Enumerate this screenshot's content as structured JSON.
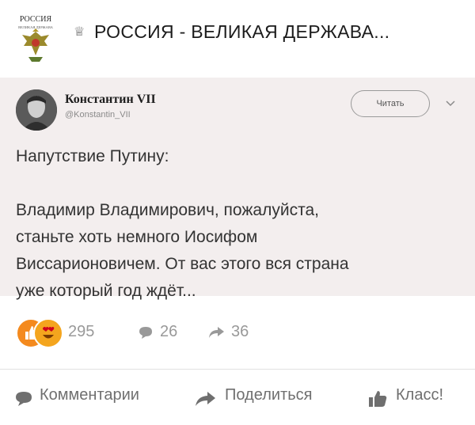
{
  "group": {
    "title": "РОССИЯ - ВЕЛИКАЯ ДЕРЖАВА...",
    "logo_text_top": "РОССИЯ",
    "logo_text_bottom": "ВЕЛИКАЯ ДЕРЖАВА",
    "crown_glyph": "♕"
  },
  "tweet": {
    "author": "Константин VII",
    "handle": "@Konstantin_VII",
    "follow_label": "Читать",
    "lines": [
      "Напутствие Путину:",
      "",
      "Владимир Владимирович, пожалуйста,",
      "станьте хоть немного Иосифом",
      "Виссарионовичем. От вас этого вся страна",
      "уже который год ждёт..."
    ]
  },
  "stats": {
    "reactions": "295",
    "comments": "26",
    "shares": "36"
  },
  "actions": {
    "comment_label": "Комментарии",
    "share_label": "Поделиться",
    "like_label": "Класс!"
  },
  "colors": {
    "tweet_bg": "#f3eeee",
    "like_orange": "#f48a1e",
    "muted_text": "#999999",
    "action_text": "#6f6f6f"
  }
}
